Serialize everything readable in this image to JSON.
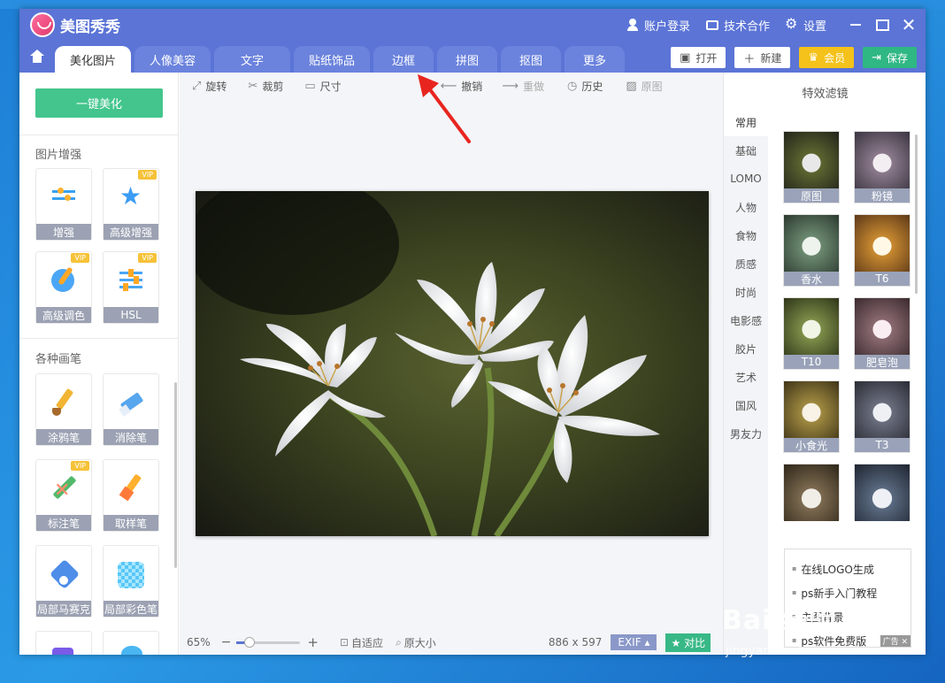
{
  "app": {
    "title": "美图秀秀"
  },
  "top_links": {
    "account": "账户登录",
    "cooperation": "技术合作",
    "settings": "设置"
  },
  "tabs": [
    {
      "label": "美化图片"
    },
    {
      "label": "人像美容"
    },
    {
      "label": "文字"
    },
    {
      "label": "贴纸饰品"
    },
    {
      "label": "边框"
    },
    {
      "label": "拼图"
    },
    {
      "label": "抠图"
    },
    {
      "label": "更多"
    }
  ],
  "header_buttons": {
    "open": "打开",
    "new": "新建",
    "vip": "会员",
    "save": "保存"
  },
  "left": {
    "one_click": "一键美化",
    "section_enhance": "图片增强",
    "section_brushes": "各种画笔",
    "vip_badge": "VIP",
    "tools": [
      {
        "label": "增强"
      },
      {
        "label": "高级增强"
      },
      {
        "label": "高级调色"
      },
      {
        "label": "HSL"
      },
      {
        "label": "涂鸦笔"
      },
      {
        "label": "消除笔"
      },
      {
        "label": "标注笔"
      },
      {
        "label": "取样笔"
      },
      {
        "label": "局部马赛克"
      },
      {
        "label": "局部彩色笔"
      }
    ]
  },
  "toolbar": {
    "rotate": "旋转",
    "crop": "裁剪",
    "size": "尺寸",
    "undo": "撤销",
    "redo": "重做",
    "history": "历史",
    "original": "原图"
  },
  "bottom": {
    "zoom_pct": "65%",
    "zoom_level": 0.2,
    "fit": "自适应",
    "actual_size": "原大小",
    "dimensions": "886 x 597",
    "exif": "EXIF",
    "compare": "对比"
  },
  "right": {
    "title": "特效滤镜",
    "categories": [
      "常用",
      "基础",
      "LOMO",
      "人物",
      "食物",
      "质感",
      "时尚",
      "电影感",
      "胶片",
      "艺术",
      "国风",
      "男友力"
    ],
    "filters": [
      {
        "label": "原图"
      },
      {
        "label": "粉镜"
      },
      {
        "label": "香水"
      },
      {
        "label": "T6"
      },
      {
        "label": "T10"
      },
      {
        "label": "肥皂泡"
      },
      {
        "label": "小食光"
      },
      {
        "label": "T3"
      }
    ],
    "ads": [
      "在线LOGO生成",
      "ps新手入门教程",
      "主图背景",
      "ps软件免费版"
    ],
    "ad_tag": "广告"
  },
  "watermark": {
    "brand": "Bai 经验",
    "url": "jingyan.baidu.com"
  }
}
